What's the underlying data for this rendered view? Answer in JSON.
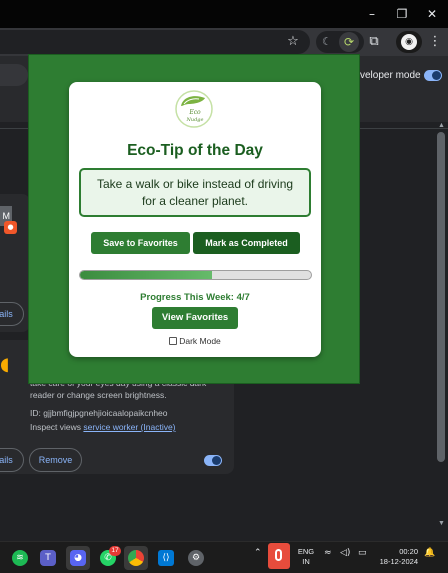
{
  "window": {
    "minimize": "–",
    "maximize": "❐",
    "close": "✕"
  },
  "toolbar": {
    "bookmark_icon": "star-icon",
    "extensions_icon": "puzzle-icon"
  },
  "extensions_page": {
    "developer_mode_label": "veloper mode",
    "card1": {
      "letter": "M",
      "details_label": "ails"
    },
    "card2": {
      "description": "take care of your eyes day using a classic dark reader or change screen brightness.",
      "id_text": "ID: gjjbmfigjpgnehjioicaalopaikcnheo",
      "inspect_label": "Inspect views",
      "inspect_link": "service worker (Inactive)",
      "details_label": "ails",
      "remove_label": "Remove"
    }
  },
  "popup": {
    "logo_text_1": "Eco",
    "logo_text_2": "Nudge",
    "title": "Eco-Tip of the Day",
    "tip_line_1": "Take a walk or bike instead of driving",
    "tip_line_2": "for a cleaner planet.",
    "save_button": "Save to Favorites",
    "complete_button": "Mark as Completed",
    "progress_fraction": 0.57,
    "progress_text": "Progress This Week: 4/7",
    "view_favorites_button": "View Favorites",
    "dark_mode_label": "Dark Mode",
    "colors": {
      "primary": "#2e7d32",
      "primary_dark": "#1b5e20",
      "tip_bg": "#eaf5ea"
    }
  },
  "taskbar": {
    "apps": [
      "spotify-icon",
      "teams-icon",
      "discord-icon",
      "whatsapp-icon",
      "chrome-icon",
      "vscode-icon",
      "settings-icon"
    ],
    "whatsapp_badge": "17",
    "lang_1": "ENG",
    "lang_2": "IN",
    "time": "00:20",
    "date": "18-12-2024"
  }
}
